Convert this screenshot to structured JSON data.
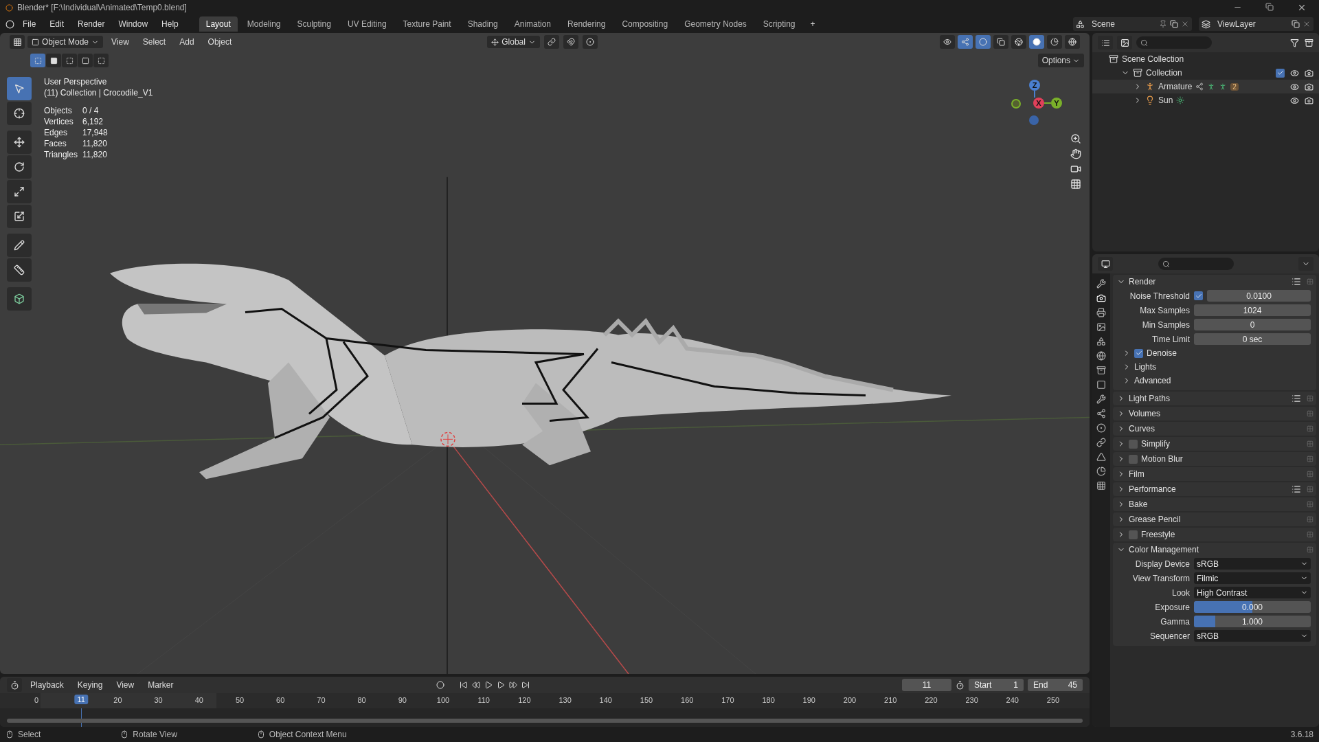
{
  "window": {
    "title": "Blender* [F:\\Individual\\Animated\\Temp0.blend]",
    "version": "3.6.18"
  },
  "menu": [
    "File",
    "Edit",
    "Render",
    "Window",
    "Help"
  ],
  "workspaces": [
    {
      "label": "Layout",
      "selected": true
    },
    {
      "label": "Modeling",
      "selected": false
    },
    {
      "label": "Sculpting",
      "selected": false
    },
    {
      "label": "UV Editing",
      "selected": false
    },
    {
      "label": "Texture Paint",
      "selected": false
    },
    {
      "label": "Shading",
      "selected": false
    },
    {
      "label": "Animation",
      "selected": false
    },
    {
      "label": "Rendering",
      "selected": false
    },
    {
      "label": "Compositing",
      "selected": false
    },
    {
      "label": "Geometry Nodes",
      "selected": false
    },
    {
      "label": "Scripting",
      "selected": false
    }
  ],
  "add_workspace": "+",
  "scene": "Scene",
  "view_layer": "ViewLayer",
  "viewport": {
    "mode": "Object Mode",
    "menus": [
      "View",
      "Select",
      "Add",
      "Object"
    ],
    "orientation": "Global",
    "options": "Options",
    "overlay_title": "User Perspective",
    "overlay_subtitle": "(11) Collection | Crocodile_V1",
    "stats": [
      {
        "label": "Objects",
        "value": "0 / 4"
      },
      {
        "label": "Vertices",
        "value": "6,192"
      },
      {
        "label": "Edges",
        "value": "17,948"
      },
      {
        "label": "Faces",
        "value": "11,820"
      },
      {
        "label": "Triangles",
        "value": "11,820"
      }
    ],
    "gizmo": {
      "z": "Z",
      "x": "X",
      "y": "Y"
    }
  },
  "outliner": {
    "items": [
      {
        "label": "Scene Collection",
        "kind": "scene",
        "selected": false,
        "children": [
          {
            "label": "Collection",
            "kind": "collection",
            "expanded": true,
            "checked": true,
            "selected": false,
            "children": [
              {
                "label": "Armature",
                "kind": "armature",
                "expanded": false,
                "badge": "2",
                "selected": true
              },
              {
                "label": "Sun",
                "kind": "light",
                "expanded": false,
                "selected": false
              }
            ]
          }
        ]
      }
    ]
  },
  "properties": {
    "panels": [
      {
        "title": "Render",
        "expanded": true,
        "presets": true,
        "fields": [
          {
            "label": "Noise Threshold",
            "value": "0.0100",
            "kind": "number",
            "checked": true
          },
          {
            "label": "Max Samples",
            "value": "1024",
            "kind": "number"
          },
          {
            "label": "Min Samples",
            "value": "0",
            "kind": "number"
          },
          {
            "label": "Time Limit",
            "value": "0 sec",
            "kind": "number"
          }
        ],
        "subpanels": [
          {
            "title": "Denoise",
            "expanded": false,
            "checked": true
          },
          {
            "title": "Lights",
            "expanded": false
          },
          {
            "title": "Advanced",
            "expanded": false
          }
        ]
      },
      {
        "title": "Light Paths",
        "expanded": false,
        "presets": true
      },
      {
        "title": "Volumes",
        "expanded": false
      },
      {
        "title": "Curves",
        "expanded": false
      },
      {
        "title": "Simplify",
        "expanded": false,
        "checked": false
      },
      {
        "title": "Motion Blur",
        "expanded": false,
        "checked": false
      },
      {
        "title": "Film",
        "expanded": false
      },
      {
        "title": "Performance",
        "expanded": false,
        "presets": true
      },
      {
        "title": "Bake",
        "expanded": false
      },
      {
        "title": "Grease Pencil",
        "expanded": false
      },
      {
        "title": "Freestyle",
        "expanded": false,
        "checked": false
      },
      {
        "title": "Color Management",
        "expanded": true,
        "fields": [
          {
            "label": "Display Device",
            "value": "sRGB",
            "kind": "dropdown"
          },
          {
            "label": "View Transform",
            "value": "Filmic",
            "kind": "dropdown"
          },
          {
            "label": "Look",
            "value": "High Contrast",
            "kind": "dropdown"
          },
          {
            "label": "Exposure",
            "value": "0.000",
            "kind": "slider",
            "level": 0.5
          },
          {
            "label": "Gamma",
            "value": "1.000",
            "kind": "slider",
            "level": 0.18
          },
          {
            "label": "Sequencer",
            "value": "sRGB",
            "kind": "dropdown"
          }
        ]
      }
    ]
  },
  "timeline": {
    "menus": [
      "Playback",
      "Keying",
      "View",
      "Marker"
    ],
    "current_frame": "11",
    "start_label": "Start",
    "start": "1",
    "end_label": "End",
    "end": "45",
    "playhead": "11",
    "ruler": [
      "0",
      "20",
      "30",
      "40",
      "50",
      "60",
      "70",
      "80",
      "90",
      "100",
      "110",
      "120",
      "130",
      "140",
      "150",
      "160",
      "170",
      "180",
      "190",
      "200",
      "210",
      "220",
      "230",
      "240",
      "250"
    ]
  },
  "status_bar": [
    "Select",
    "Rotate View",
    "Object Context Menu"
  ]
}
